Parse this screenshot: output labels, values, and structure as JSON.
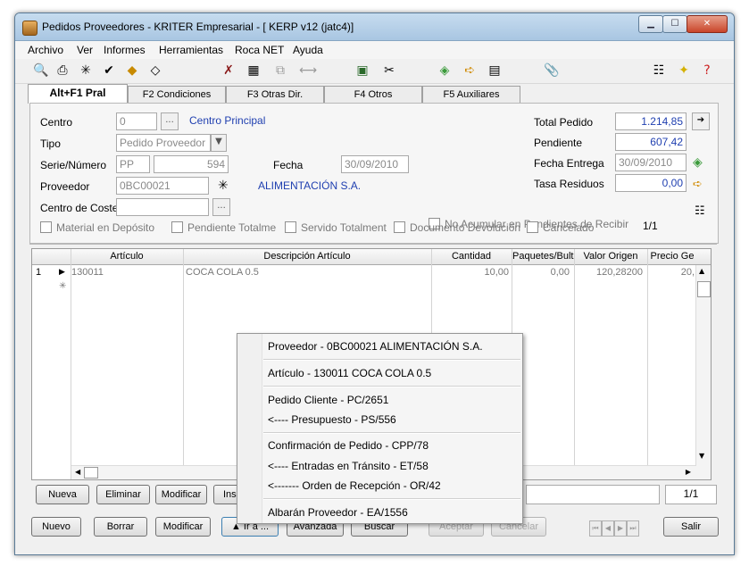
{
  "window": {
    "title": "Pedidos Proveedores - KRITER Empresarial - [ KERP v12 (jatc4)]"
  },
  "menu": [
    "Archivo",
    "Ver",
    "Informes",
    "Herramientas",
    "Roca NET",
    "Ayuda"
  ],
  "toolbar_icons": [
    "print-preview-icon",
    "print-icon",
    "asterisk-icon",
    "check-icon",
    "warning-icon",
    "erase-icon",
    "clear-icon",
    "calculator-icon",
    "copy-icon",
    "link-icon",
    "save-icon",
    "cut-icon",
    "note-icon",
    "next-icon",
    "export-icon",
    "attach-icon",
    "checklist-icon",
    "bulb-icon",
    "help-icon"
  ],
  "tabs": [
    "Alt+F1 Pral",
    "F2 Condiciones",
    "F3 Otras Dir.",
    "F4 Otros",
    "F5 Auxiliares"
  ],
  "form": {
    "centro_label": "Centro",
    "centro_value": "0",
    "centro_desc": "Centro Principal",
    "tipo_label": "Tipo",
    "tipo_value": "Pedido Proveedor",
    "serie_label": "Serie/Número",
    "serie_value": "PP",
    "numero_value": "594",
    "fecha_label": "Fecha",
    "fecha_value": "30/09/2010",
    "proveedor_label": "Proveedor",
    "proveedor_value": "0BC00021",
    "proveedor_desc": "ALIMENTACIÓN S.A.",
    "coste_label": "Centro de Coste",
    "total_label": "Total Pedido",
    "total_value": "1.214,85",
    "pendiente_label": "Pendiente",
    "pendiente_value": "607,42",
    "entrega_label": "Fecha Entrega",
    "entrega_value": "30/09/2010",
    "residuos_label": "Tasa Residuos",
    "residuos_value": "0,00",
    "no_acumular": "No Acumular en Pendientes de Recibir",
    "checks": [
      "Material en Depósito",
      "Pendiente Totalme",
      "Servido Totalment",
      "Documento Devolución",
      "Cancelado"
    ],
    "page_counter": "1/1"
  },
  "grid": {
    "headers": [
      "Artículo",
      "Descripción Artículo",
      "Cantidad",
      "Paquetes/Bult",
      "Valor Origen",
      "Precio Ge"
    ],
    "rows": [
      {
        "num": "1",
        "articulo": "130011",
        "descripcion": "COCA COLA 0.5",
        "cantidad": "10,00",
        "paquetes": "0,00",
        "valor": "120,28200",
        "precio": "20,"
      }
    ],
    "page_counter": "1/1"
  },
  "line_buttons": {
    "nueva": "Nueva",
    "eliminar": "Eliminar",
    "modificar": "Modificar",
    "insertar": "Ins"
  },
  "bottom_buttons": {
    "nuevo": "Nuevo",
    "borrar": "Borrar",
    "modificar": "Modificar",
    "ira": "▲ Ir a ...",
    "avanzada": "Avanzada",
    "buscar": "Buscar",
    "aceptar": "Aceptar",
    "cancelar": "Cancelar",
    "salir": "Salir"
  },
  "context_menu": [
    "Proveedor - 0BC00021 ALIMENTACIÓN S.A.",
    "Artículo - 130011 COCA COLA 0.5",
    "Pedido Cliente - PC/2651",
    "<---- Presupuesto - PS/556",
    "Confirmación de Pedido - CPP/78",
    "<---- Entradas en Tránsito - ET/58",
    "<------- Orden de Recepción - OR/42",
    "Albarán Proveedor - EA/1556"
  ]
}
